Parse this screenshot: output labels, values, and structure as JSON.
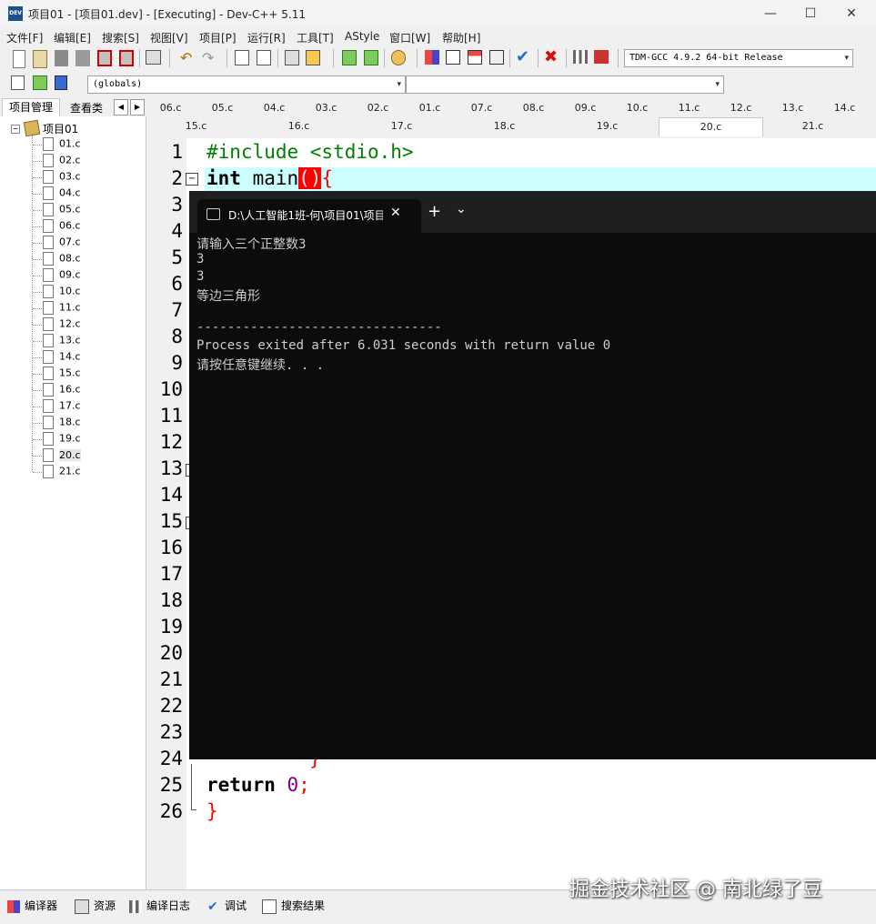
{
  "window": {
    "title": "项目01 - [项目01.dev] - [Executing] - Dev-C++ 5.11",
    "icon_text": "DEV",
    "controls": [
      "—",
      "☐",
      "✕"
    ]
  },
  "menu": [
    "文件[F]",
    "编辑[E]",
    "搜索[S]",
    "视图[V]",
    "项目[P]",
    "运行[R]",
    "工具[T]",
    "AStyle",
    "窗口[W]",
    "帮助[H]"
  ],
  "toolbar": {
    "compiler_select": "TDM-GCC 4.9.2 64-bit Release",
    "scope_select": "(globals)",
    "function_select": ""
  },
  "left_panel": {
    "tabs": [
      "项目管理",
      "查看类"
    ],
    "project_name": "项目01",
    "files": [
      "01.c",
      "02.c",
      "03.c",
      "04.c",
      "05.c",
      "06.c",
      "07.c",
      "08.c",
      "09.c",
      "10.c",
      "11.c",
      "12.c",
      "13.c",
      "14.c",
      "15.c",
      "16.c",
      "17.c",
      "18.c",
      "19.c",
      "20.c",
      "21.c"
    ],
    "selected_file": "20.c"
  },
  "file_tabs": {
    "row1": [
      "06.c",
      "05.c",
      "04.c",
      "03.c",
      "02.c",
      "01.c",
      "07.c",
      "08.c",
      "09.c",
      "10.c",
      "11.c",
      "12.c",
      "13.c",
      "14.c"
    ],
    "row2": [
      "15.c",
      "16.c",
      "17.c",
      "18.c",
      "19.c",
      "20.c",
      "21.c"
    ],
    "active": "20.c"
  },
  "editor": {
    "line_numbers": [
      "1",
      "2",
      "3",
      "4",
      "5",
      "6",
      "7",
      "8",
      "9",
      "10",
      "11",
      "12",
      "13",
      "14",
      "15",
      "16",
      "17",
      "18",
      "19",
      "20",
      "21",
      "22",
      "23",
      "24",
      "25",
      "26"
    ],
    "line1": "#include <stdio.h>",
    "line2_kw": "int",
    "line2_fn": " main",
    "line2_parens": "()",
    "line2_brace": "{",
    "line24": "}",
    "line25_kw": "return",
    "line25_num": "0",
    "line25_semi": ";",
    "line26": "}"
  },
  "console": {
    "tab_title": "D:\\人工智能1班-何\\项目01\\项目",
    "tab_close": "✕",
    "new_tab": "+",
    "dropdown": "⌄",
    "lines": [
      "请输入三个正整数3",
      "3",
      "3",
      "等边三角形",
      "",
      "--------------------------------",
      "Process exited after 6.031 seconds with return value 0",
      "请按任意键继续. . ."
    ]
  },
  "bottom_tabs": [
    "编译器",
    "资源",
    "编译日志",
    "调试",
    "搜索结果"
  ],
  "watermark": "掘金技术社区 @ 南北绿了豆",
  "colors": {
    "keyword": "#000000",
    "preprocessor": "#008000",
    "brace": "#ff0000",
    "number": "#800080",
    "highlight_line": "#ccffff",
    "console_bg": "#0c0c0c"
  }
}
